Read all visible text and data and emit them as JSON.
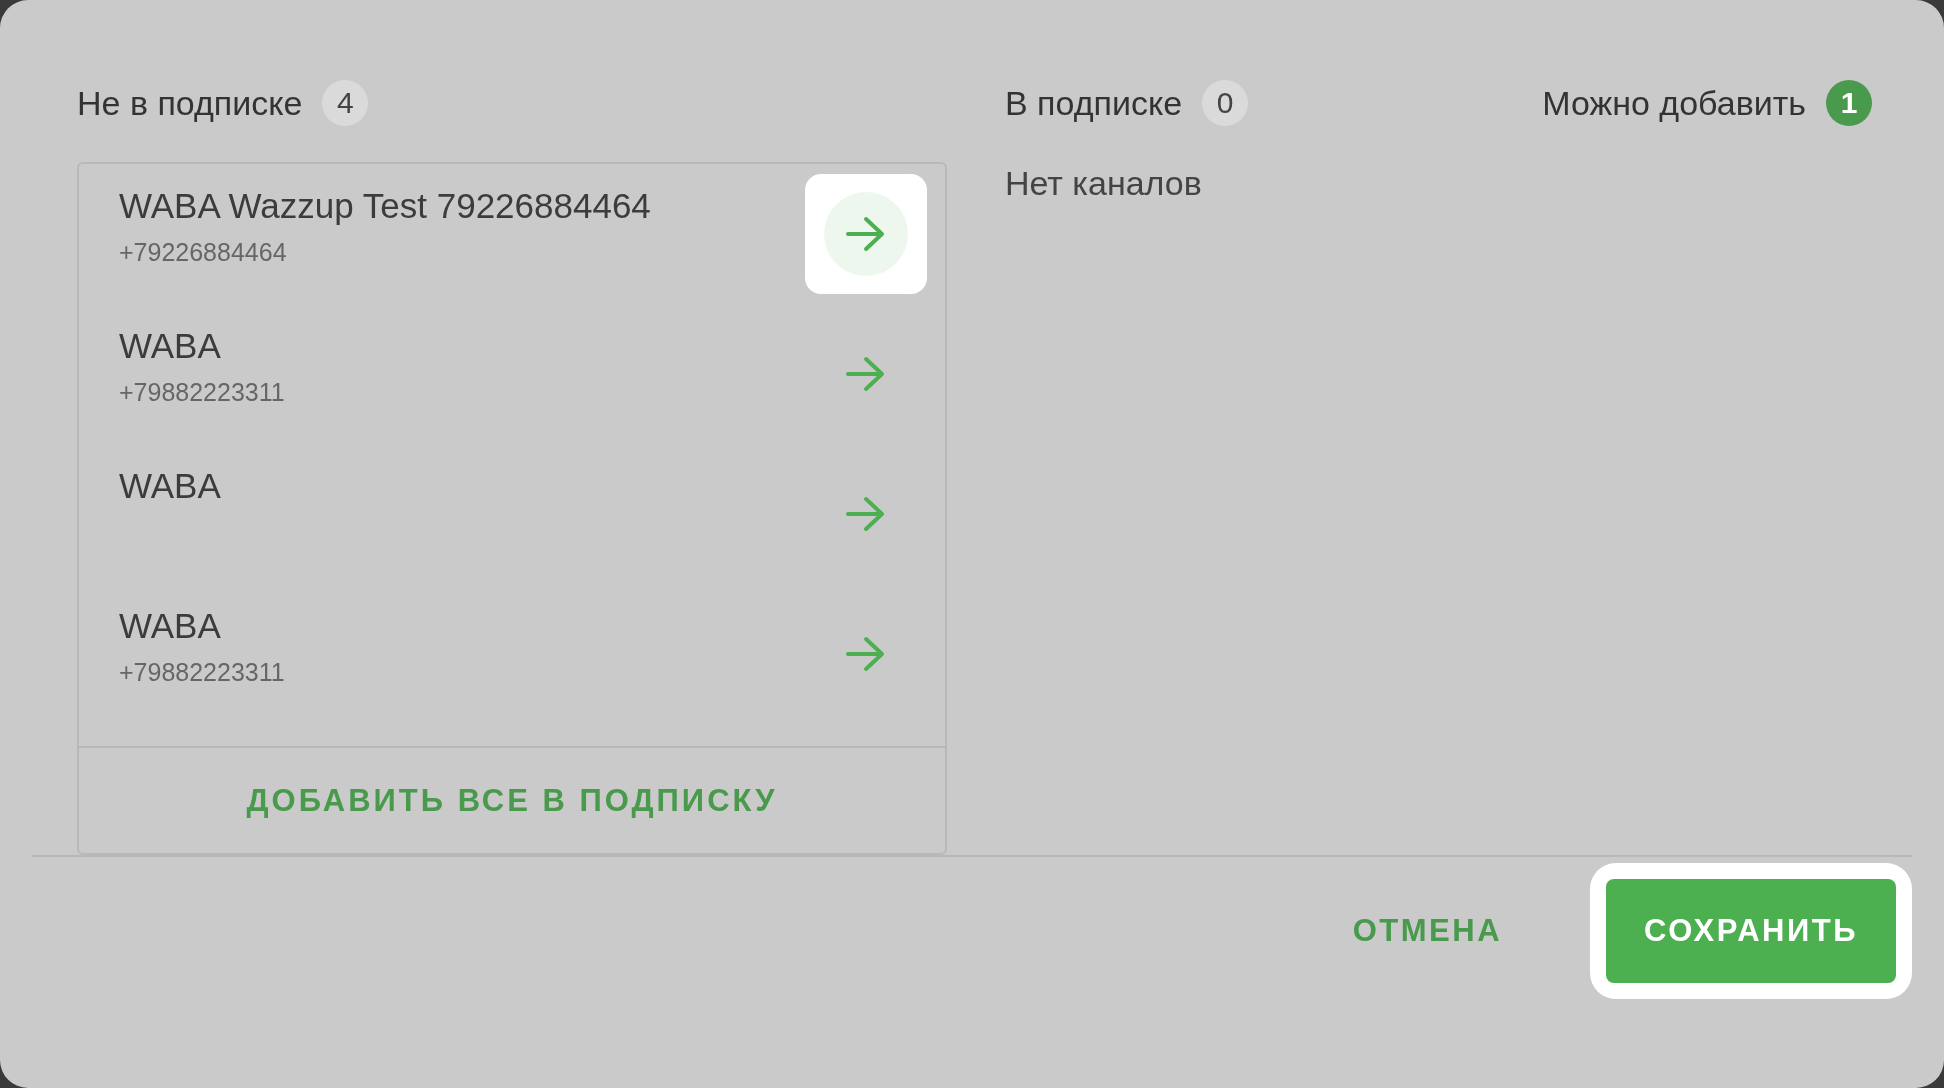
{
  "source": {
    "title": "Не в подписке",
    "count": "4",
    "color": "#dadada",
    "channels": [
      {
        "name": "WABA Wazzup Test 79226884464",
        "phone": "+79226884464",
        "highlighted": true
      },
      {
        "name": "WABA",
        "phone": "+79882223311",
        "highlighted": false
      },
      {
        "name": "WABA",
        "highlighted": false
      },
      {
        "name": "WABA",
        "phone": "+79882223311",
        "highlighted": false
      }
    ],
    "add_all": "ДОБАВИТЬ ВСЕ В ПОДПИСКУ"
  },
  "subscribed": {
    "title": "В подписке",
    "count": "0",
    "color": "#dadada",
    "empty_text": "Нет каналов"
  },
  "available": {
    "title": "Можно добавить",
    "count": "1",
    "color": "#4a9a4e"
  },
  "buttons": [
    {
      "label": "ОТМЕНА",
      "kind": "text",
      "highlighted": false
    },
    {
      "label": "СОХРАНИТЬ",
      "kind": "primary",
      "highlighted": true
    }
  ]
}
